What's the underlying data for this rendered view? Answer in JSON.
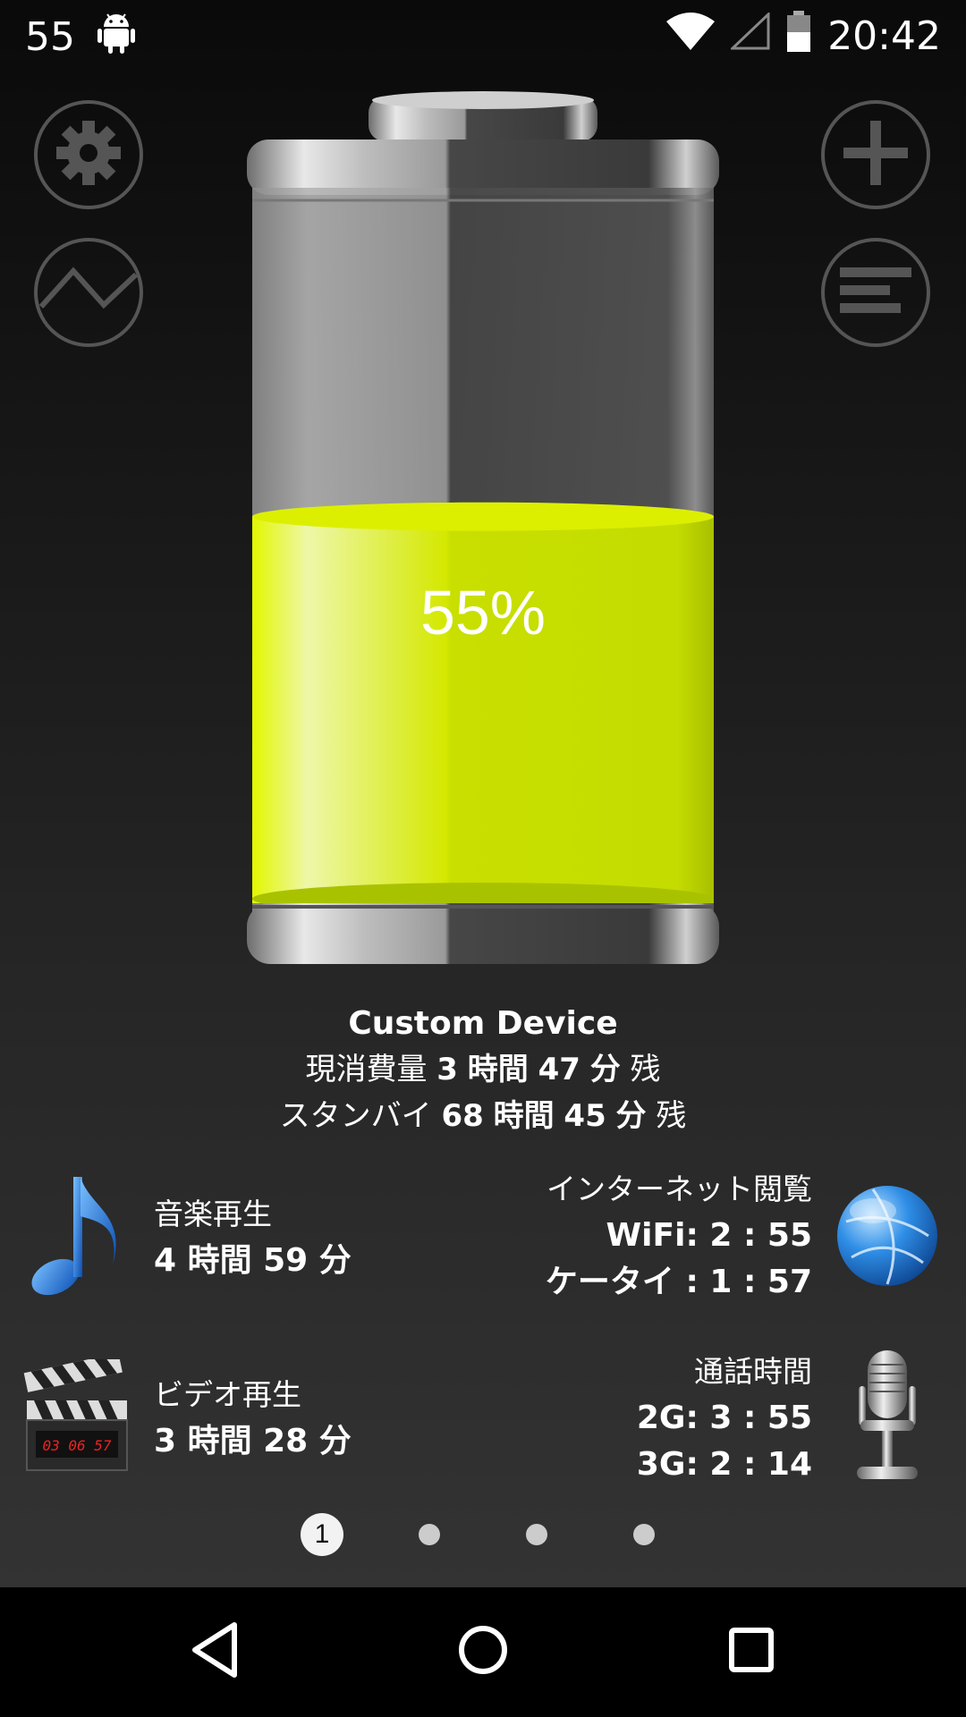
{
  "status_bar": {
    "battery_level": "55",
    "time": "20:42",
    "icons": [
      "android-icon",
      "wifi-icon",
      "cell-signal-icon",
      "battery-icon"
    ]
  },
  "toolbar": {
    "left": [
      "gear-icon",
      "graph-icon"
    ],
    "right": [
      "plus-icon",
      "list-icon"
    ]
  },
  "battery": {
    "percent_label": "55%",
    "level": 0.55,
    "fill_color": "#d8e800"
  },
  "device": {
    "name": "Custom Device",
    "line1_prefix": "現消費量",
    "line1_hours": "3",
    "line1_hours_unit": "時間",
    "line1_minutes": "47",
    "line1_minutes_unit": "分",
    "line1_suffix": "残",
    "line2_prefix": "スタンバイ",
    "line2_hours": "68",
    "line2_hours_unit": "時間",
    "line2_minutes": "45",
    "line2_minutes_unit": "分",
    "line2_suffix": "残"
  },
  "usage": {
    "music": {
      "label": "音楽再生",
      "value": "4 時間 59 分",
      "icon": "music-note-icon"
    },
    "video": {
      "label": "ビデオ再生",
      "value": "3 時間 28 分",
      "icon": "clapperboard-icon",
      "clock": "03 06 57"
    },
    "internet": {
      "label": "インターネット閲覧",
      "wifi": "WiFi: 2 : 55",
      "mobile": "ケータイ : 1 : 57",
      "icon": "globe-icon"
    },
    "call": {
      "label": "通話時間",
      "g2": "2G: 3 : 55",
      "g3": "3G: 2 : 14",
      "icon": "microphone-icon"
    }
  },
  "pager": {
    "current": "1",
    "count": 4
  },
  "nav": [
    "back-icon",
    "home-icon",
    "recents-icon"
  ]
}
